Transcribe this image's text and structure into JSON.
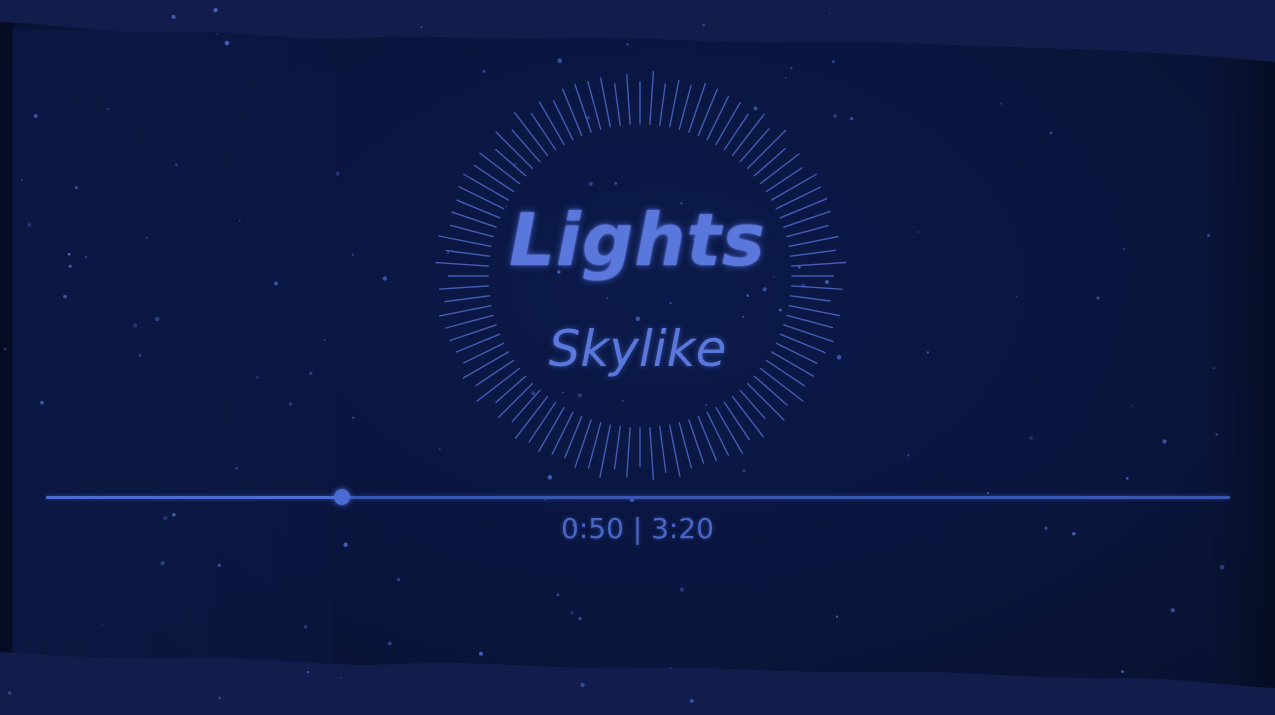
{
  "track": {
    "title": "Lights",
    "artist": "Skylike"
  },
  "playback": {
    "current_time": "0:50",
    "separator": "|",
    "total_time": "3:20",
    "time_display": "0:50 | 3:20",
    "progress_fraction": 0.25
  },
  "colors": {
    "background": "#0a1438",
    "accent": "#5a78dc",
    "track": "#3a56b0",
    "ray": "#4e68c8"
  },
  "icons": {
    "visualizer": "radial-spectrum-ring"
  }
}
